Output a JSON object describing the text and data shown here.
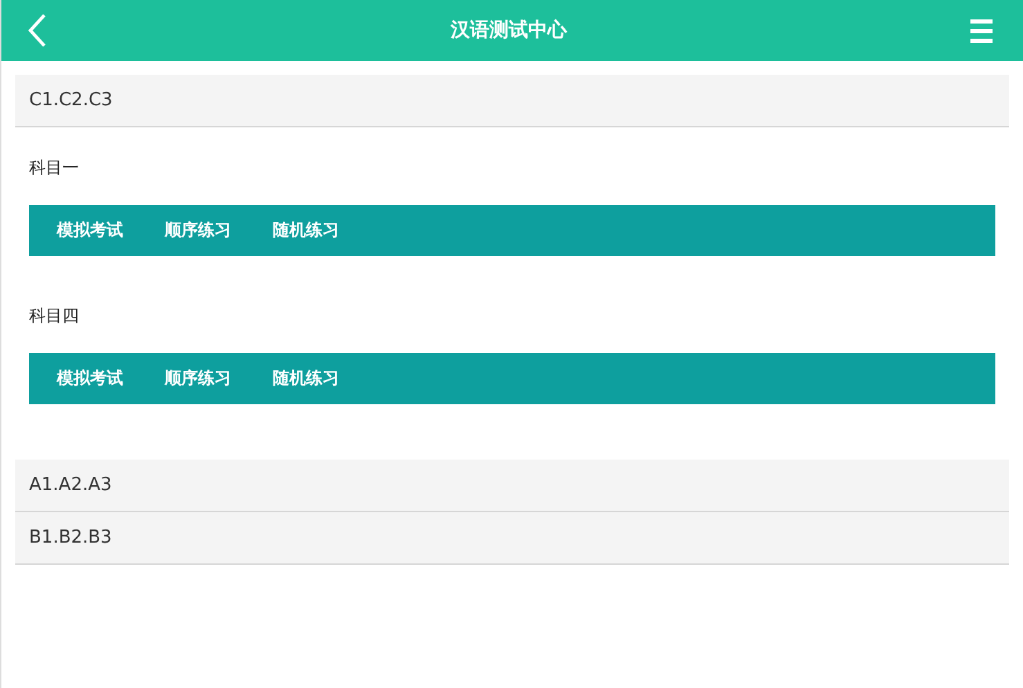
{
  "header": {
    "title": "汉语测试中心"
  },
  "items": [
    {
      "kind": "group",
      "label": "C1.C2.C3"
    },
    {
      "kind": "subject",
      "title": "科目一",
      "actions": [
        "模拟考试",
        "顺序练习",
        "随机练习"
      ]
    },
    {
      "kind": "subject",
      "title": "科目四",
      "actions": [
        "模拟考试",
        "顺序练习",
        "随机练习"
      ]
    },
    {
      "kind": "group",
      "label": "A1.A2.A3"
    },
    {
      "kind": "group",
      "label": "B1.B2.B3"
    }
  ]
}
